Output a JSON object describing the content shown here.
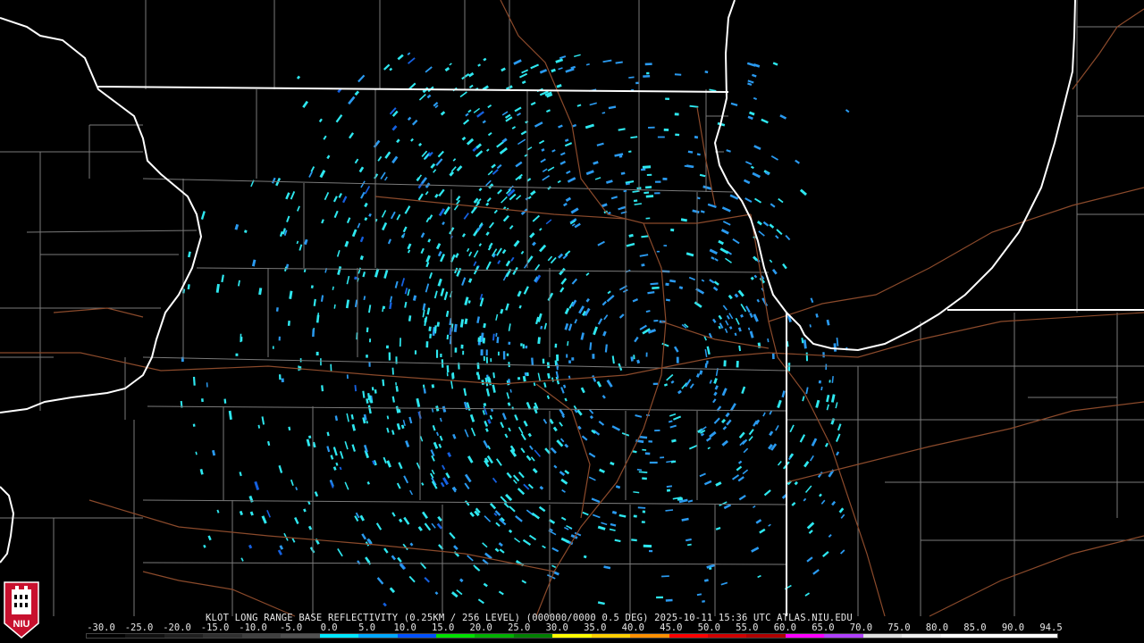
{
  "map": {
    "title": "KLOT LONG RANGE BASE REFLECTIVITY (0.25KM / 256 LEVEL) (000000/0000 0.5 DEG) 2025-10-11 15:36 UTC  ATLAS.NIU.EDU",
    "logo_text": "NIU",
    "colors": {
      "background": "#000000",
      "state_border": "#ffffff",
      "county_border": "#808080",
      "roads": "#8b4a2b",
      "echo_light": "#2ee8f0",
      "echo_medium": "#2a9af0",
      "echo_strong": "#1560e0"
    }
  },
  "colorbar": {
    "labels": [
      "-30.0",
      "-25.0",
      "-20.0",
      "-15.0",
      "-10.0",
      "-5.0",
      "0.0",
      "5.0",
      "10.0",
      "15.0",
      "20.0",
      "25.0",
      "30.0",
      "35.0",
      "40.0",
      "45.0",
      "50.0",
      "55.0",
      "60.0",
      "65.0",
      "70.0",
      "75.0",
      "80.0",
      "85.0",
      "90.0",
      "94.5"
    ],
    "colors": [
      "#000000",
      "#101010",
      "#202020",
      "#303030",
      "#404040",
      "#505050",
      "#00e8ff",
      "#00a8ff",
      "#0050ff",
      "#00e000",
      "#00b000",
      "#008000",
      "#ffff00",
      "#ffd000",
      "#ff9000",
      "#ff0000",
      "#d00000",
      "#b00000",
      "#ff00ff",
      "#b040ff",
      "#e0e0e0",
      "#f0f0f0",
      "#ffffff",
      "#ffffff",
      "#ffffff"
    ]
  }
}
